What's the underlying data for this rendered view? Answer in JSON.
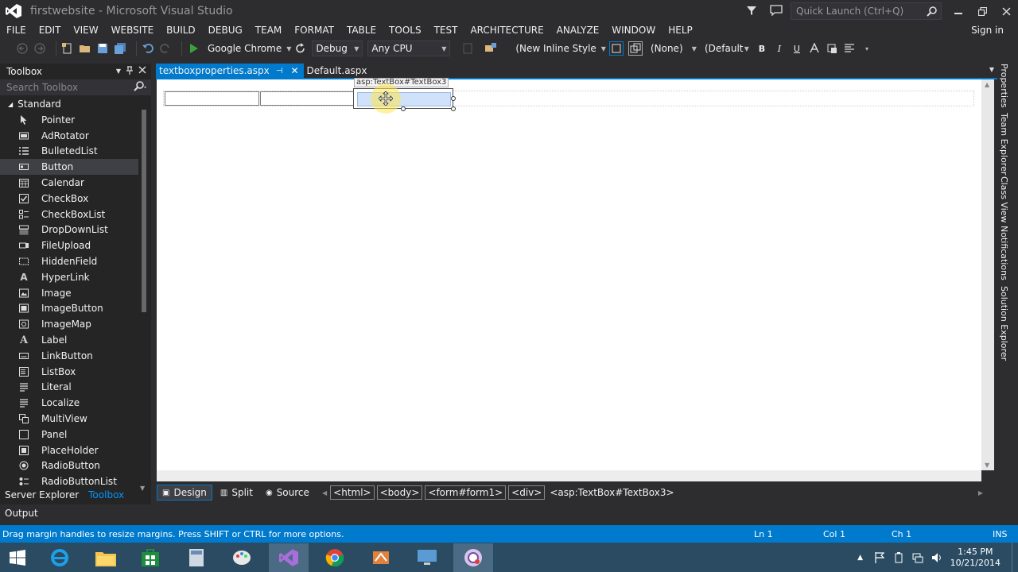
{
  "window": {
    "title": "firstwebsite - Microsoft Visual Studio",
    "quick_launch_placeholder": "Quick Launch (Ctrl+Q)",
    "sign_in": "Sign in"
  },
  "menu": [
    "FILE",
    "EDIT",
    "VIEW",
    "WEBSITE",
    "BUILD",
    "DEBUG",
    "TEAM",
    "FORMAT",
    "TABLE",
    "TOOLS",
    "TEST",
    "ARCHITECTURE",
    "ANALYZE",
    "WINDOW",
    "HELP"
  ],
  "toolbar": {
    "browser": "Google Chrome",
    "config": "Debug",
    "platform": "Any CPU",
    "style_target": "(New Inline Style",
    "class_select": "(None)",
    "font_select": "(Default",
    "bold": "B",
    "italic": "I",
    "underline": "U"
  },
  "toolbox": {
    "title": "Toolbox",
    "search_placeholder": "Search Toolbox",
    "group": "Standard",
    "items": [
      {
        "label": "Pointer",
        "icon": "pointer-icon"
      },
      {
        "label": "AdRotator",
        "icon": "adrotator-icon"
      },
      {
        "label": "BulletedList",
        "icon": "bulletedlist-icon"
      },
      {
        "label": "Button",
        "icon": "button-icon"
      },
      {
        "label": "Calendar",
        "icon": "calendar-icon"
      },
      {
        "label": "CheckBox",
        "icon": "checkbox-icon"
      },
      {
        "label": "CheckBoxList",
        "icon": "checkboxlist-icon"
      },
      {
        "label": "DropDownList",
        "icon": "dropdownlist-icon"
      },
      {
        "label": "FileUpload",
        "icon": "fileupload-icon"
      },
      {
        "label": "HiddenField",
        "icon": "hiddenfield-icon"
      },
      {
        "label": "HyperLink",
        "icon": "hyperlink-icon"
      },
      {
        "label": "Image",
        "icon": "image-icon"
      },
      {
        "label": "ImageButton",
        "icon": "imagebutton-icon"
      },
      {
        "label": "ImageMap",
        "icon": "imagemap-icon"
      },
      {
        "label": "Label",
        "icon": "label-icon"
      },
      {
        "label": "LinkButton",
        "icon": "linkbutton-icon"
      },
      {
        "label": "ListBox",
        "icon": "listbox-icon"
      },
      {
        "label": "Literal",
        "icon": "literal-icon"
      },
      {
        "label": "Localize",
        "icon": "localize-icon"
      },
      {
        "label": "MultiView",
        "icon": "multiview-icon"
      },
      {
        "label": "Panel",
        "icon": "panel-icon"
      },
      {
        "label": "PlaceHolder",
        "icon": "placeholder-icon"
      },
      {
        "label": "RadioButton",
        "icon": "radiobutton-icon"
      },
      {
        "label": "RadioButtonList",
        "icon": "radiobuttonlist-icon"
      }
    ],
    "selected": "Button",
    "bottom_tabs": [
      "Server Explorer",
      "Toolbox"
    ]
  },
  "documents": {
    "tabs": [
      "textboxproperties.aspx",
      "Default.aspx"
    ],
    "active": "textboxproperties.aspx"
  },
  "designer": {
    "selection_tag": "asp:TextBox#TextBox3"
  },
  "viewbar": {
    "views": [
      "Design",
      "Split",
      "Source"
    ],
    "active_view": "Design",
    "breadcrumbs": [
      "<html>",
      "<body>",
      "<form#form1>",
      "<div>",
      "<asp:TextBox#TextBox3>"
    ]
  },
  "side_tabs": [
    "Properties",
    "Team Explorer",
    "Class View",
    "Notifications",
    "Solution Explorer"
  ],
  "output_label": "Output",
  "status": {
    "message": "Drag margin handles to resize margins. Press SHIFT or CTRL for more options.",
    "line": "Ln 1",
    "col": "Col 1",
    "ch": "Ch 1",
    "mode": "INS"
  },
  "taskbar": {
    "time": "1:45 PM",
    "date": "10/21/2014"
  },
  "colors": {
    "accent": "#007acc",
    "chrome": "#2d2d30",
    "taskbar": "#2a4b62"
  }
}
